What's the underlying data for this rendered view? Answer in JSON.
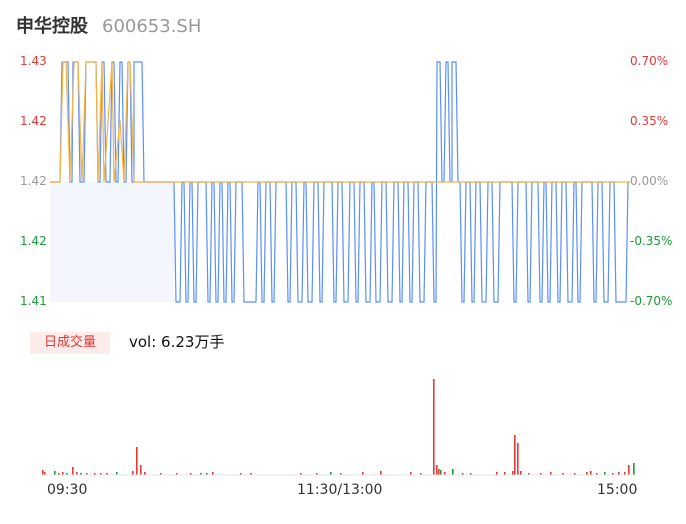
{
  "header": {
    "name": "申华控股",
    "code": "600653.SH"
  },
  "price_axis": {
    "left_ticks": [
      "1.43",
      "1.42",
      "1.42",
      "1.42",
      "1.41"
    ],
    "right_ticks": [
      "0.70%",
      "0.35%",
      "0.00%",
      "-0.35%",
      "-0.70%"
    ],
    "colors": {
      "up": "#e53935",
      "flat": "#999999",
      "down": "#1a9b3a"
    }
  },
  "volume": {
    "tag_label": "日成交量",
    "vol_text": "vol: 6.23万手"
  },
  "time_axis": {
    "start": "09:30",
    "mid": "11:30/13:00",
    "end": "15:00"
  },
  "colors": {
    "price_line": "#5b8ff9",
    "avg_line": "#f5b342",
    "fill": "#f3f6fc",
    "vol_up": "#e53935",
    "vol_down": "#1a9b3a"
  },
  "chart_data": {
    "type": "line",
    "title": "",
    "xlabel": "",
    "ylabel": "",
    "x_range": [
      "09:30",
      "15:00"
    ],
    "ylim": [
      1.41,
      1.43
    ],
    "series": [],
    "notes_price_levels": [
      1.43,
      1.42,
      1.41
    ],
    "volume_total": "6.23万手"
  }
}
